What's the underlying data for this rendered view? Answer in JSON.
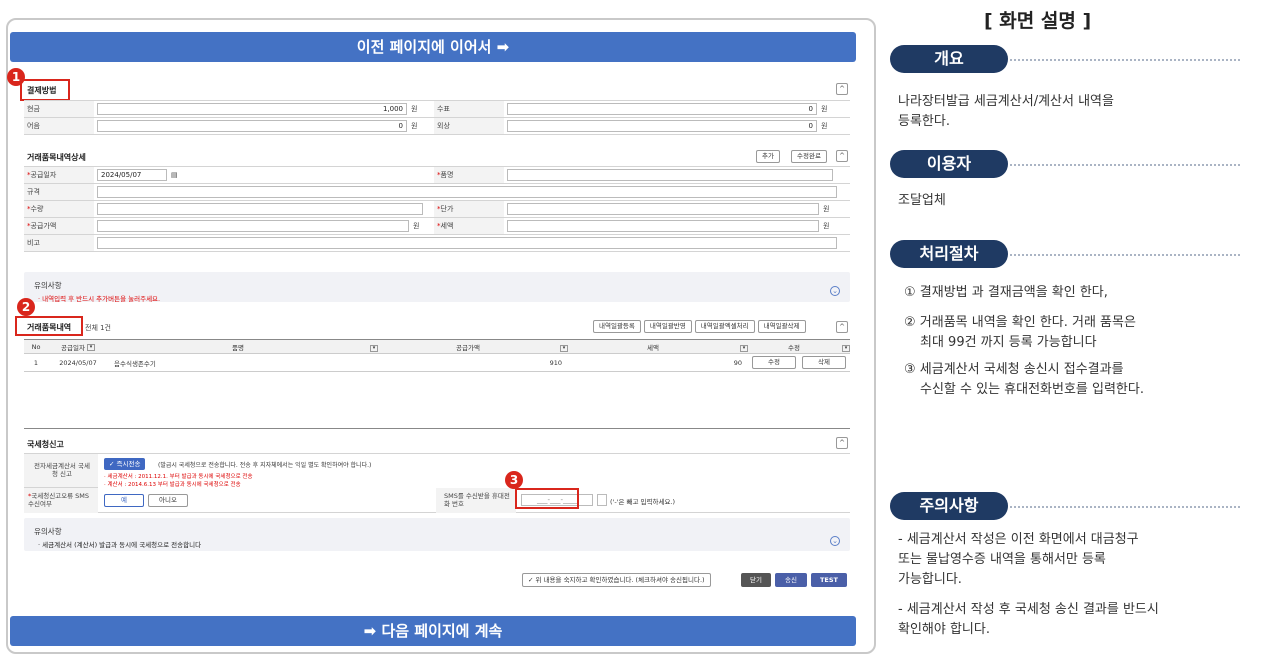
{
  "banner": {
    "top": "이전 페이지에 이어서 ➡",
    "bottom": "➡ 다음 페이지에 계속"
  },
  "markers": [
    "1",
    "2",
    "3"
  ],
  "payment": {
    "title": "결제방법",
    "rows": [
      {
        "l1": "현금",
        "v1": "1,000",
        "u1": "원",
        "l2": "수표",
        "v2": "0",
        "u2": "원"
      },
      {
        "l1": "어음",
        "v1": "0",
        "u1": "원",
        "l2": "외상",
        "v2": "0",
        "u2": "원"
      }
    ]
  },
  "items_detail": {
    "title": "거래품목내역상세",
    "btn_add": "추가",
    "btn_edit_done": "수정완료",
    "supply_date_label": "공급일자",
    "supply_date_value": "2024/05/07",
    "item_name_label": "품명",
    "spec_label": "규격",
    "qty_label": "수량",
    "unit_price_label": "단가",
    "unit_won": "원",
    "supply_amount_label": "공급가액",
    "tax_label": "세액",
    "note_label": "비고"
  },
  "notice1": {
    "title": "유의사항",
    "text": "· 내역입력 후 반드시 추가버튼을 눌러주세요."
  },
  "items_list": {
    "title": "거래품목내역",
    "count": "전체 1건",
    "buttons": [
      "내역일괄등록",
      "내역일괄반영",
      "내역일괄엑셀처리",
      "내역일괄삭제"
    ],
    "headers": [
      "No",
      "공급일자",
      "품명",
      "공급가액",
      "세액",
      "수정"
    ],
    "rows": [
      {
        "no": "1",
        "date": "2024/05/07",
        "name": "음수식생존수기",
        "amount": "910",
        "tax": "90",
        "edit": "수정",
        "del": "삭제"
      }
    ]
  },
  "nts": {
    "title": "국세청신고",
    "e_label": "전자세금계산서 국세청 신고",
    "immediate_btn": "✓ 즉시전송",
    "immediate_desc": "(발급시 국세청으로 전송합니다. 전송 후 지자체에서는 익일 별도 확인하여야 합니다.)",
    "note_a": "· 세금계산서 : 2011.12.1. 부터 발급과 동시에 국세청으로 전송",
    "note_b": "· 계산서 : 2014.6.13 부터 발급과 동시에 국세청으로 전송",
    "sms_label": "국세청신고오류 SMS수신여부",
    "yes": "예",
    "no": "아니오",
    "phone_label": "SMS를 수신받을 휴대전화 번호",
    "phone_value": "___-___-____",
    "phone_hint": "('-'은 빼고 입력하세요.)"
  },
  "notice2": {
    "title": "유의사항",
    "text": "· 세금계산서 (계산서) 발급과 동시에 국세청으로 전송합니다"
  },
  "confirm": {
    "check_text": "✓ 위 내용을 숙지하고 확인하였습니다. (체크하셔야 송신됩니다.)",
    "close": "닫기",
    "send": "송신",
    "test": "TEST"
  },
  "panel": {
    "heading": "[ 화면 설명 ]",
    "overview_title": "개요",
    "overview_text1": "나라장터발급 세금계산서/계산서 내역을",
    "overview_text2": "등록한다.",
    "user_title": "이용자",
    "user_text": "조달업체",
    "proc_title": "처리절차",
    "proc1": "① 결재방법 과 결재금액을 확인 한다,",
    "proc2a": "② 거래품목 내역을 확인 한다. 거래 품목은",
    "proc2b": "최대 99건 까지 등록 가능합니다",
    "proc3a": "③ 세금계산서 국세청 송신시 접수결과를",
    "proc3b": "수신할 수 있는 휴대전화번호를 입력한다.",
    "caution_title": "주의사항",
    "caution1a": "- 세금계산서 작성은 이전 화면에서  대금청구",
    "caution1b": "또는 물납영수증 내역을 통해서만 등록",
    "caution1c": "가능합니다.",
    "caution2a": "- 세금계산서 작성 후 국세청 송신 결과를 반드시",
    "caution2b": "확인해야 합니다."
  },
  "colors": {
    "banner": "#4472c4",
    "pill": "#1f3a63",
    "marker": "#d9261c",
    "send_btn": "#4a5fa8"
  }
}
